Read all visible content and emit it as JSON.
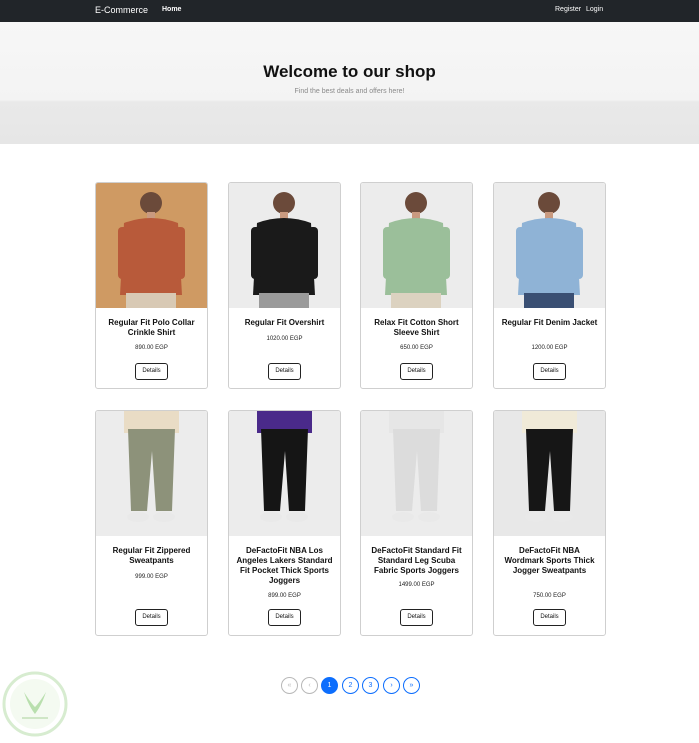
{
  "navbar": {
    "brand": "E-Commerce",
    "home": "Home",
    "register": "Register",
    "login": "Login"
  },
  "hero": {
    "title": "Welcome to our shop",
    "subtitle": "Find the best deals and offers here!"
  },
  "products": [
    {
      "title": "Regular Fit Polo Collar Crinkle Shirt",
      "price": "890.00 EGP",
      "button": "Details",
      "bg": "#cf9a63",
      "top": "#b85a3a",
      "bottom": "#d8c9b4"
    },
    {
      "title": "Regular Fit Overshirt",
      "price": "1020.00 EGP",
      "button": "Details",
      "bg": "#ececec",
      "top": "#1a1a1a",
      "bottom": "#9a9a9a"
    },
    {
      "title": "Relax Fit Cotton Short Sleeve Shirt",
      "price": "650.00 EGP",
      "button": "Details",
      "bg": "#ececec",
      "top": "#9bbf9a",
      "bottom": "#dcd2c0"
    },
    {
      "title": "Regular Fit Denim Jacket",
      "price": "1200.00 EGP",
      "button": "Details",
      "bg": "#ececec",
      "top": "#8fb3d6",
      "bottom": "#3a4f73"
    },
    {
      "title": "Regular Fit Zippered Sweatpants",
      "price": "999.00 EGP",
      "button": "Details",
      "bg": "#ececec",
      "top": "#e9dcc5",
      "bottom": "#8d927a"
    },
    {
      "title": "DeFactoFit NBA Los Angeles Lakers Standard Fit Pocket Thick Sports Joggers",
      "price": "899.00 EGP",
      "button": "Details",
      "bg": "#ececec",
      "top": "#4a2a8a",
      "bottom": "#151515"
    },
    {
      "title": "DeFactoFit Standard Fit Standard Leg Scuba Fabric Sports Joggers",
      "price": "1499.00 EGP",
      "button": "Details",
      "bg": "#ececec",
      "top": "#e6e6e6",
      "bottom": "#dcdcdc"
    },
    {
      "title": "DeFactoFit NBA Wordmark Sports Thick Jogger Sweatpants",
      "price": "750.00 EGP",
      "button": "Details",
      "bg": "#e8e8e8",
      "top": "#f0ead8",
      "bottom": "#161616"
    }
  ],
  "pagination": {
    "first": "«",
    "prev": "‹",
    "pages": [
      "1",
      "2",
      "3"
    ],
    "next": "›",
    "last": "»",
    "active_page": "1"
  },
  "colors": {
    "navbar": "#212529",
    "accent": "#0d6efd"
  }
}
